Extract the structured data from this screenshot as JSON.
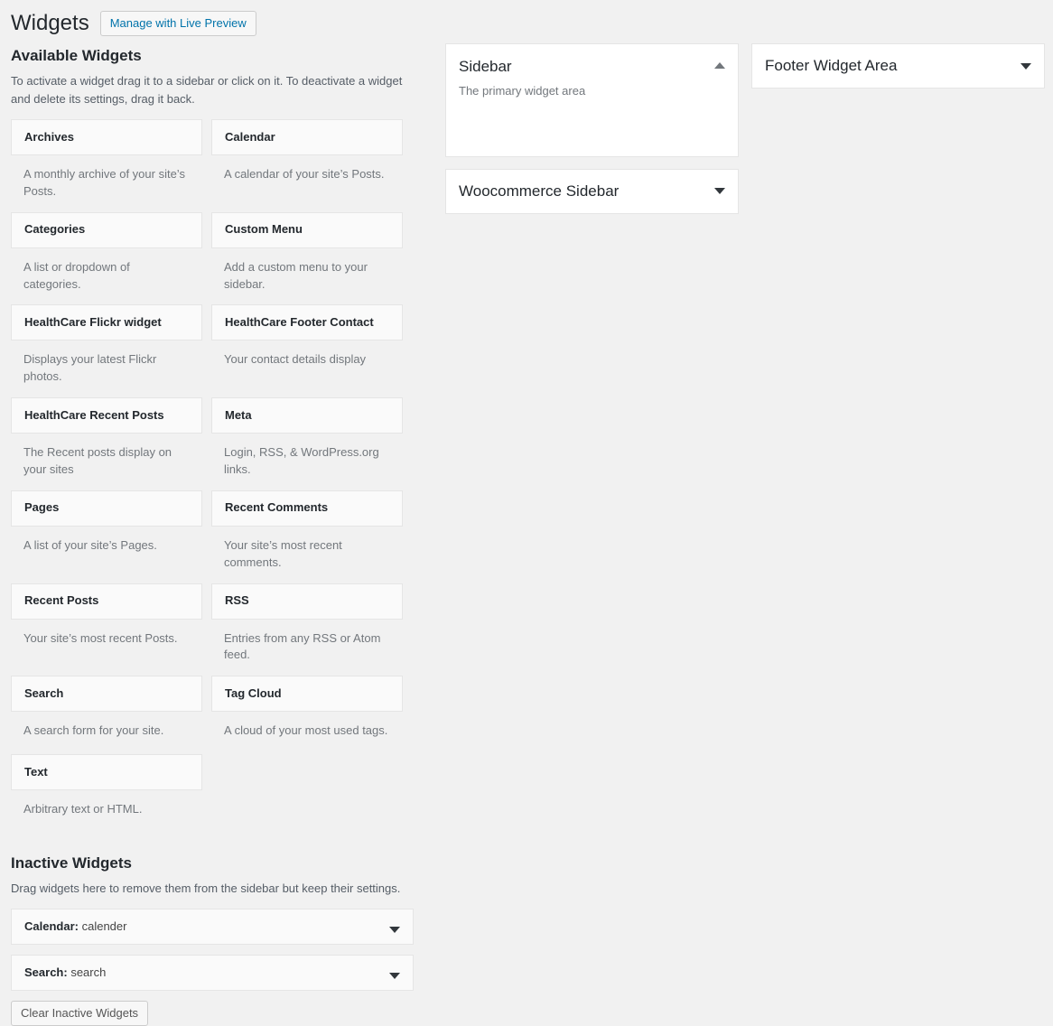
{
  "header": {
    "title": "Widgets",
    "live_preview_button": "Manage with Live Preview"
  },
  "available": {
    "title": "Available Widgets",
    "description": "To activate a widget drag it to a sidebar or click on it. To deactivate a widget and delete its settings, drag it back.",
    "widgets": [
      {
        "name": "Archives",
        "description": "A monthly archive of your site’s Posts."
      },
      {
        "name": "Calendar",
        "description": "A calendar of your site’s Posts."
      },
      {
        "name": "Categories",
        "description": "A list or dropdown of categories."
      },
      {
        "name": "Custom Menu",
        "description": "Add a custom menu to your sidebar."
      },
      {
        "name": "HealthCare Flickr widget",
        "description": "Displays your latest Flickr photos."
      },
      {
        "name": "HealthCare Footer Contact",
        "description": "Your contact details display"
      },
      {
        "name": "HealthCare Recent Posts",
        "description": "The Recent posts display on your sites"
      },
      {
        "name": "Meta",
        "description": "Login, RSS, & WordPress.org links."
      },
      {
        "name": "Pages",
        "description": "A list of your site’s Pages."
      },
      {
        "name": "Recent Comments",
        "description": "Your site’s most recent comments."
      },
      {
        "name": "Recent Posts",
        "description": "Your site’s most recent Posts."
      },
      {
        "name": "RSS",
        "description": "Entries from any RSS or Atom feed."
      },
      {
        "name": "Search",
        "description": "A search form for your site."
      },
      {
        "name": "Tag Cloud",
        "description": "A cloud of your most used tags."
      },
      {
        "name": "Text",
        "description": "Arbitrary text or HTML."
      }
    ]
  },
  "inactive": {
    "title": "Inactive Widgets",
    "description": "Drag widgets here to remove them from the sidebar but keep their settings.",
    "items": [
      {
        "type": "Calendar:",
        "instance": "calender",
        "toggle_icon": "chevron-down-icon"
      },
      {
        "type": "Search:",
        "instance": "search",
        "toggle_icon": "chevron-down-icon"
      }
    ],
    "clear_button": "Clear Inactive Widgets"
  },
  "sidebar_columns": [
    {
      "panels": [
        {
          "title": "Sidebar",
          "description": "The primary widget area",
          "expanded": true,
          "toggle_icon": "chevron-up-icon"
        },
        {
          "title": "Woocommerce Sidebar",
          "description": "",
          "expanded": false,
          "toggle_icon": "chevron-down-icon"
        }
      ]
    },
    {
      "panels": [
        {
          "title": "Footer Widget Area",
          "description": "",
          "expanded": false,
          "toggle_icon": "chevron-down-icon"
        }
      ]
    }
  ],
  "colors": {
    "page_background": "#f1f1f1",
    "card_background": "#fafafa",
    "panel_background": "#ffffff",
    "border": "#e5e5e5",
    "link_blue": "#0073aa",
    "heading": "#23282d",
    "muted_text": "#72777c"
  }
}
